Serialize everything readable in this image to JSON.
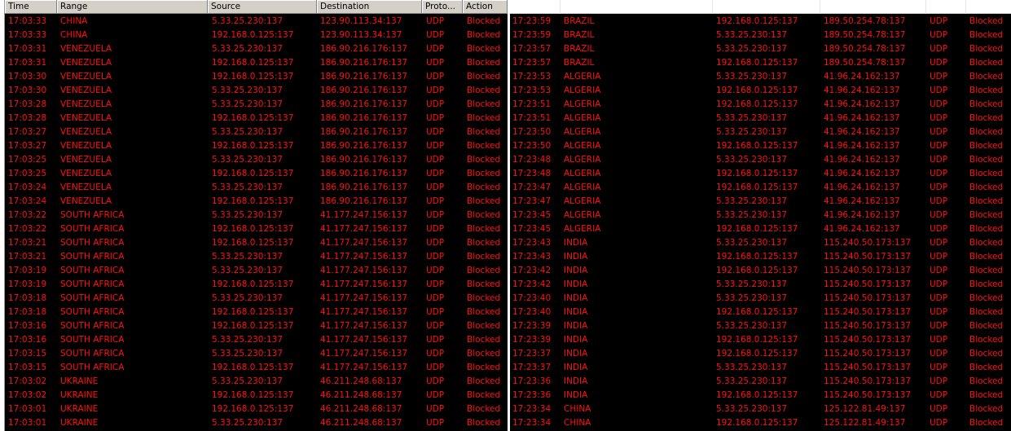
{
  "columns": [
    "Time",
    "Range",
    "Source",
    "Destination",
    "Proto...",
    "Action"
  ],
  "left_rows": [
    [
      "17:03:33",
      "CHINA",
      "5.33.25.230:137",
      "123.90.113.34:137",
      "UDP",
      "Blocked"
    ],
    [
      "17:03:33",
      "CHINA",
      "192.168.0.125:137",
      "123.90.113.34:137",
      "UDP",
      "Blocked"
    ],
    [
      "17:03:31",
      "VENEZUELA",
      "5.33.25.230:137",
      "186.90.216.176:137",
      "UDP",
      "Blocked"
    ],
    [
      "17:03:31",
      "VENEZUELA",
      "192.168.0.125:137",
      "186.90.216.176:137",
      "UDP",
      "Blocked"
    ],
    [
      "17:03:30",
      "VENEZUELA",
      "192.168.0.125:137",
      "186.90.216.176:137",
      "UDP",
      "Blocked"
    ],
    [
      "17:03:30",
      "VENEZUELA",
      "5.33.25.230:137",
      "186.90.216.176:137",
      "UDP",
      "Blocked"
    ],
    [
      "17:03:28",
      "VENEZUELA",
      "5.33.25.230:137",
      "186.90.216.176:137",
      "UDP",
      "Blocked"
    ],
    [
      "17:03:28",
      "VENEZUELA",
      "192.168.0.125:137",
      "186.90.216.176:137",
      "UDP",
      "Blocked"
    ],
    [
      "17:03:27",
      "VENEZUELA",
      "5.33.25.230:137",
      "186.90.216.176:137",
      "UDP",
      "Blocked"
    ],
    [
      "17:03:27",
      "VENEZUELA",
      "192.168.0.125:137",
      "186.90.216.176:137",
      "UDP",
      "Blocked"
    ],
    [
      "17:03:25",
      "VENEZUELA",
      "5.33.25.230:137",
      "186.90.216.176:137",
      "UDP",
      "Blocked"
    ],
    [
      "17:03:25",
      "VENEZUELA",
      "192.168.0.125:137",
      "186.90.216.176:137",
      "UDP",
      "Blocked"
    ],
    [
      "17:03:24",
      "VENEZUELA",
      "5.33.25.230:137",
      "186.90.216.176:137",
      "UDP",
      "Blocked"
    ],
    [
      "17:03:24",
      "VENEZUELA",
      "192.168.0.125:137",
      "186.90.216.176:137",
      "UDP",
      "Blocked"
    ],
    [
      "17:03:22",
      "SOUTH AFRICA",
      "5.33.25.230:137",
      "41.177.247.156:137",
      "UDP",
      "Blocked"
    ],
    [
      "17:03:22",
      "SOUTH AFRICA",
      "192.168.0.125:137",
      "41.177.247.156:137",
      "UDP",
      "Blocked"
    ],
    [
      "17:03:21",
      "SOUTH AFRICA",
      "192.168.0.125:137",
      "41.177.247.156:137",
      "UDP",
      "Blocked"
    ],
    [
      "17:03:21",
      "SOUTH AFRICA",
      "5.33.25.230:137",
      "41.177.247.156:137",
      "UDP",
      "Blocked"
    ],
    [
      "17:03:19",
      "SOUTH AFRICA",
      "5.33.25.230:137",
      "41.177.247.156:137",
      "UDP",
      "Blocked"
    ],
    [
      "17:03:19",
      "SOUTH AFRICA",
      "192.168.0.125:137",
      "41.177.247.156:137",
      "UDP",
      "Blocked"
    ],
    [
      "17:03:18",
      "SOUTH AFRICA",
      "5.33.25.230:137",
      "41.177.247.156:137",
      "UDP",
      "Blocked"
    ],
    [
      "17:03:18",
      "SOUTH AFRICA",
      "192.168.0.125:137",
      "41.177.247.156:137",
      "UDP",
      "Blocked"
    ],
    [
      "17:03:16",
      "SOUTH AFRICA",
      "192.168.0.125:137",
      "41.177.247.156:137",
      "UDP",
      "Blocked"
    ],
    [
      "17:03:16",
      "SOUTH AFRICA",
      "5.33.25.230:137",
      "41.177.247.156:137",
      "UDP",
      "Blocked"
    ],
    [
      "17:03:15",
      "SOUTH AFRICA",
      "5.33.25.230:137",
      "41.177.247.156:137",
      "UDP",
      "Blocked"
    ],
    [
      "17:03:15",
      "SOUTH AFRICA",
      "192.168.0.125:137",
      "41.177.247.156:137",
      "UDP",
      "Blocked"
    ],
    [
      "17:03:02",
      "UKRAINE",
      "5.33.25.230:137",
      "46.211.248.68:137",
      "UDP",
      "Blocked"
    ],
    [
      "17:03:02",
      "UKRAINE",
      "192.168.0.125:137",
      "46.211.248.68:137",
      "UDP",
      "Blocked"
    ],
    [
      "17:03:01",
      "UKRAINE",
      "192.168.0.125:137",
      "46.211.248.68:137",
      "UDP",
      "Blocked"
    ],
    [
      "17:03:01",
      "UKRAINE",
      "5.33.25.230:137",
      "46.211.248.68:137",
      "UDP",
      "Blocked"
    ]
  ],
  "right_rows": [
    [
      "17:23:59",
      "BRAZIL",
      "192.168.0.125:137",
      "189.50.254.78:137",
      "UDP",
      "Blocked"
    ],
    [
      "17:23:59",
      "BRAZIL",
      "5.33.25.230:137",
      "189.50.254.78:137",
      "UDP",
      "Blocked"
    ],
    [
      "17:23:57",
      "BRAZIL",
      "5.33.25.230:137",
      "189.50.254.78:137",
      "UDP",
      "Blocked"
    ],
    [
      "17:23:57",
      "BRAZIL",
      "192.168.0.125:137",
      "189.50.254.78:137",
      "UDP",
      "Blocked"
    ],
    [
      "17:23:53",
      "ALGERIA",
      "5.33.25.230:137",
      "41.96.24.162:137",
      "UDP",
      "Blocked"
    ],
    [
      "17:23:53",
      "ALGERIA",
      "192.168.0.125:137",
      "41.96.24.162:137",
      "UDP",
      "Blocked"
    ],
    [
      "17:23:51",
      "ALGERIA",
      "192.168.0.125:137",
      "41.96.24.162:137",
      "UDP",
      "Blocked"
    ],
    [
      "17:23:51",
      "ALGERIA",
      "5.33.25.230:137",
      "41.96.24.162:137",
      "UDP",
      "Blocked"
    ],
    [
      "17:23:50",
      "ALGERIA",
      "5.33.25.230:137",
      "41.96.24.162:137",
      "UDP",
      "Blocked"
    ],
    [
      "17:23:50",
      "ALGERIA",
      "192.168.0.125:137",
      "41.96.24.162:137",
      "UDP",
      "Blocked"
    ],
    [
      "17:23:48",
      "ALGERIA",
      "5.33.25.230:137",
      "41.96.24.162:137",
      "UDP",
      "Blocked"
    ],
    [
      "17:23:48",
      "ALGERIA",
      "192.168.0.125:137",
      "41.96.24.162:137",
      "UDP",
      "Blocked"
    ],
    [
      "17:23:47",
      "ALGERIA",
      "192.168.0.125:137",
      "41.96.24.162:137",
      "UDP",
      "Blocked"
    ],
    [
      "17:23:47",
      "ALGERIA",
      "5.33.25.230:137",
      "41.96.24.162:137",
      "UDP",
      "Blocked"
    ],
    [
      "17:23:45",
      "ALGERIA",
      "5.33.25.230:137",
      "41.96.24.162:137",
      "UDP",
      "Blocked"
    ],
    [
      "17:23:45",
      "ALGERIA",
      "192.168.0.125:137",
      "41.96.24.162:137",
      "UDP",
      "Blocked"
    ],
    [
      "17:23:43",
      "INDIA",
      "5.33.25.230:137",
      "115.240.50.173:137",
      "UDP",
      "Blocked"
    ],
    [
      "17:23:43",
      "INDIA",
      "192.168.0.125:137",
      "115.240.50.173:137",
      "UDP",
      "Blocked"
    ],
    [
      "17:23:42",
      "INDIA",
      "192.168.0.125:137",
      "115.240.50.173:137",
      "UDP",
      "Blocked"
    ],
    [
      "17:23:42",
      "INDIA",
      "5.33.25.230:137",
      "115.240.50.173:137",
      "UDP",
      "Blocked"
    ],
    [
      "17:23:40",
      "INDIA",
      "5.33.25.230:137",
      "115.240.50.173:137",
      "UDP",
      "Blocked"
    ],
    [
      "17:23:40",
      "INDIA",
      "192.168.0.125:137",
      "115.240.50.173:137",
      "UDP",
      "Blocked"
    ],
    [
      "17:23:39",
      "INDIA",
      "5.33.25.230:137",
      "115.240.50.173:137",
      "UDP",
      "Blocked"
    ],
    [
      "17:23:39",
      "INDIA",
      "192.168.0.125:137",
      "115.240.50.173:137",
      "UDP",
      "Blocked"
    ],
    [
      "17:23:37",
      "INDIA",
      "192.168.0.125:137",
      "115.240.50.173:137",
      "UDP",
      "Blocked"
    ],
    [
      "17:23:37",
      "INDIA",
      "5.33.25.230:137",
      "115.240.50.173:137",
      "UDP",
      "Blocked"
    ],
    [
      "17:23:36",
      "INDIA",
      "5.33.25.230:137",
      "115.240.50.173:137",
      "UDP",
      "Blocked"
    ],
    [
      "17:23:36",
      "INDIA",
      "192.168.0.125:137",
      "115.240.50.173:137",
      "UDP",
      "Blocked"
    ],
    [
      "17:23:34",
      "CHINA",
      "5.33.25.230:137",
      "125.122.81.49:137",
      "UDP",
      "Blocked"
    ],
    [
      "17:23:34",
      "CHINA",
      "192.168.0.125:137",
      "125.122.81.49:137",
      "UDP",
      "Blocked"
    ]
  ],
  "colors": {
    "background": "#000000",
    "row_text": "#ff1010",
    "header_bg": "#d4d0c8"
  }
}
